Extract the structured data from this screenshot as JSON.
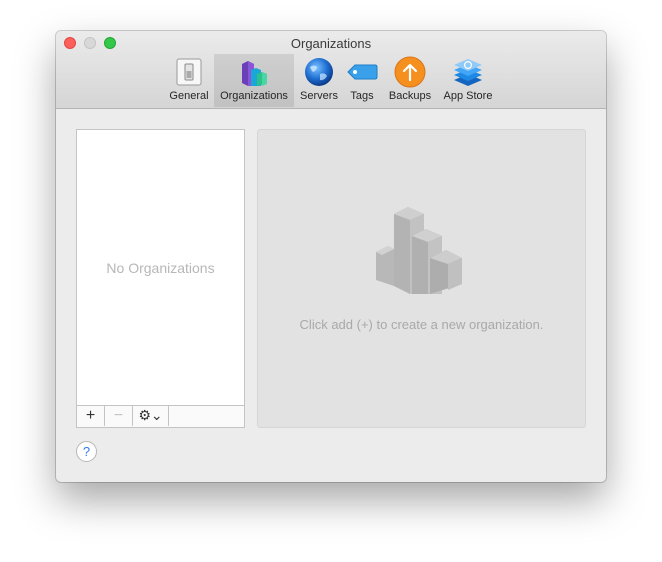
{
  "window": {
    "title": "Organizations"
  },
  "toolbar": {
    "items": [
      {
        "label": "General",
        "icon": "switch-icon"
      },
      {
        "label": "Organizations",
        "icon": "organization-buildings-icon",
        "selected": true
      },
      {
        "label": "Servers",
        "icon": "globe-icon"
      },
      {
        "label": "Tags",
        "icon": "tag-icon"
      },
      {
        "label": "Backups",
        "icon": "backup-arrow-up-icon"
      },
      {
        "label": "App Store",
        "icon": "app-store-stack-icon"
      }
    ]
  },
  "list": {
    "empty_label": "No Organizations",
    "add_symbol": "+",
    "remove_symbol": "−",
    "gear_symbol": "⚙⌄"
  },
  "detail": {
    "hint": "Click add (+) to create a new organization."
  },
  "help": {
    "symbol": "?"
  },
  "colors": {
    "close": "#fc605b",
    "minimize_disabled": "#d8d8d8",
    "zoom": "#34c84a",
    "window_bg": "#ececec",
    "backups_orange": "#f5901e",
    "servers_blue": "#1f6fd3",
    "tags_blue": "#3aa0ea"
  }
}
